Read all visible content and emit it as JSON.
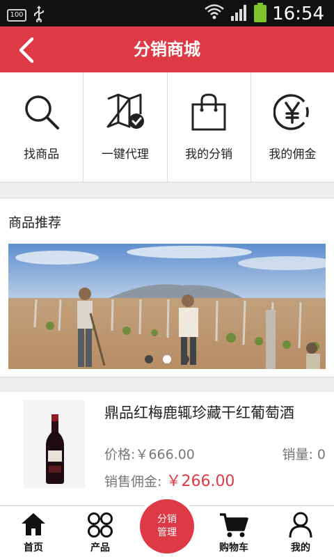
{
  "status_bar": {
    "battery_small": "100",
    "time": "16:54"
  },
  "header": {
    "title": "分销商城"
  },
  "quick_actions": [
    {
      "label": "找商品",
      "icon": "search-icon"
    },
    {
      "label": "一键代理",
      "icon": "map-check-icon"
    },
    {
      "label": "我的分销",
      "icon": "shopping-bag-icon"
    },
    {
      "label": "我的佣金",
      "icon": "yen-icon"
    }
  ],
  "recommend": {
    "heading": "商品推荐",
    "carousel": {
      "slides": 3,
      "active_index": 1
    }
  },
  "product": {
    "name": "鼎品红梅鹿辄珍藏干红葡萄酒",
    "price": "价格:￥666.00",
    "sales": "销量: 0",
    "commission_label": "销售佣金: ",
    "commission_value": "￥266.00"
  },
  "tabbar": {
    "home": "首页",
    "products": "产品",
    "center_line1": "分销",
    "center_line2": "管理",
    "cart": "购物车",
    "mine": "我的"
  },
  "colors": {
    "accent": "#dd3a46",
    "status_bar": "#111111"
  }
}
